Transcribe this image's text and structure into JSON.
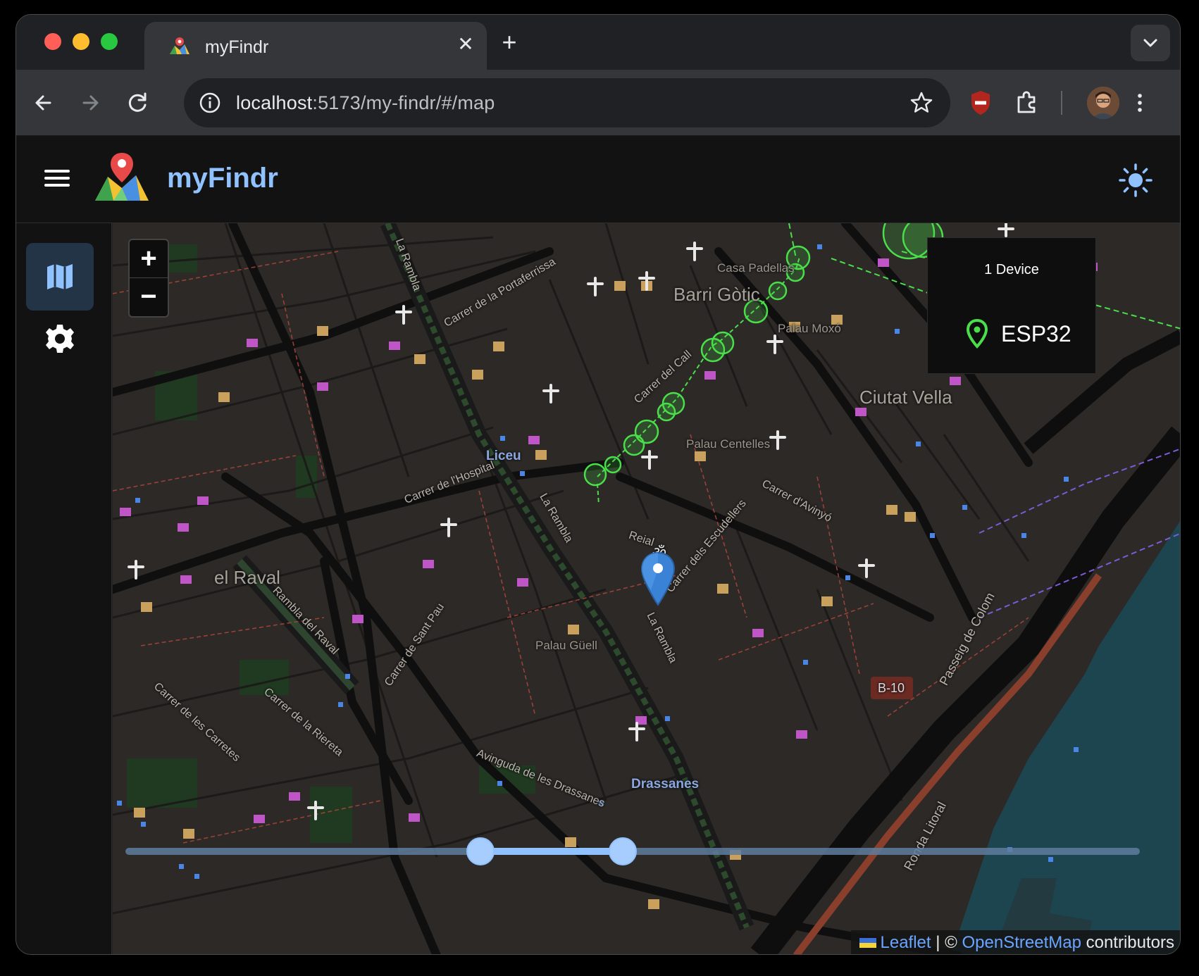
{
  "browser": {
    "tab_title": "myFindr",
    "url_host": "localhost",
    "url_rest": ":5173/my-findr/#/map"
  },
  "app": {
    "title": "myFindr",
    "accent": "#90c2ff"
  },
  "map": {
    "zoom_in_label": "+",
    "zoom_out_label": "−",
    "labels": {
      "barri_gotic": "Barri Gòtic",
      "ciutat_vella": "Ciutat Vella",
      "el_raval": "el Raval",
      "liceu": "Liceu",
      "drassanes": "Drassanes",
      "palau_guell": "Palau Güell",
      "palau_centelles": "Palau Centelles",
      "palau_moxo": "Palau Moxó",
      "casa_padellas": "Casa Padellas",
      "la_rambla_1": "La Rambla",
      "la_rambla_2": "La Rambla",
      "la_rambla_3": "La Rambla",
      "carrer_hospital": "Carrer de l'Hospital",
      "carrer_call": "Carrer del Call",
      "carrer_escudellers": "Carrer dels Escudellers",
      "carrer_avinyo": "Carrer d'Avinyó",
      "rambla_raval": "Rambla del Raval",
      "carrer_riereta": "Carrer de la Riereta",
      "carrer_sant_pau": "Carrer de Sant Pau",
      "ronda_litoral": "Ronda Litoral",
      "passeig_colom": "Passeig de Colom",
      "b10": "B-10",
      "av_drassanes": "Avinguda de les Drassanes",
      "carrer_portaferrissa": "Carrer de la Portaferrissa",
      "carrer_carretes": "Carrer de les Carretes",
      "reial": "Reial",
      "om": "ॐ"
    }
  },
  "devices": {
    "count_label": "1 Device",
    "items": [
      {
        "name": "ESP32",
        "color": "#4ade4a"
      }
    ]
  },
  "timeline": {
    "range_start": 0.35,
    "range_end": 0.49
  },
  "attribution": {
    "leaflet": "Leaflet",
    "separator": " | © ",
    "osm": "OpenStreetMap",
    "suffix": " contributors"
  }
}
